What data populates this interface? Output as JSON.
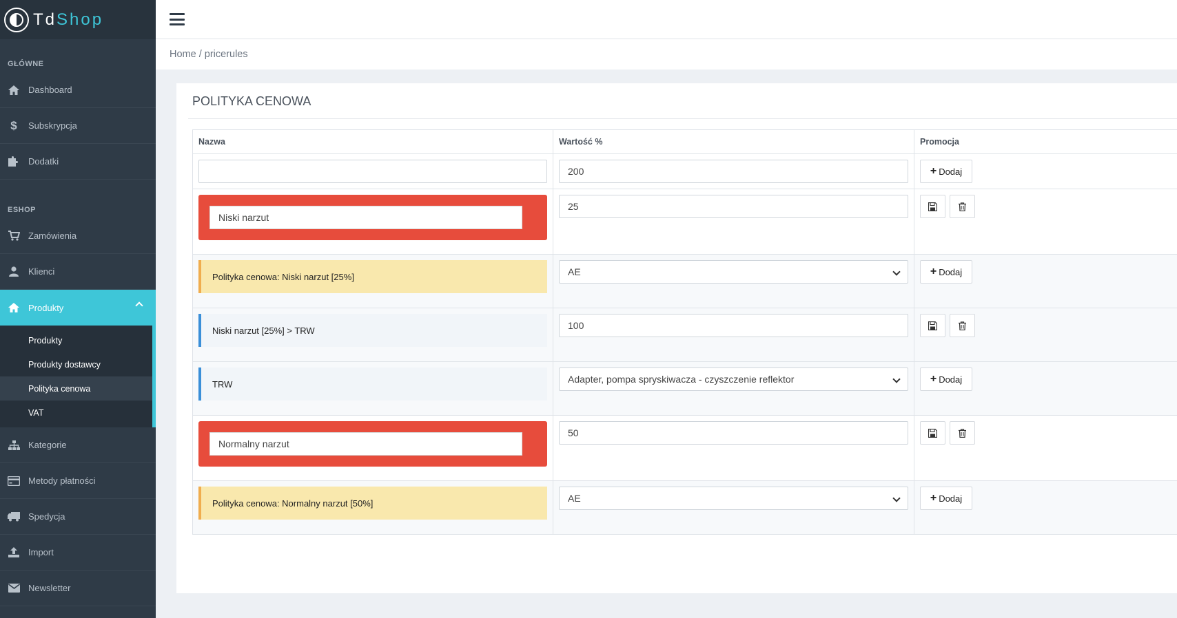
{
  "brand": {
    "name_prefix": "Td",
    "name_accent": "Shop"
  },
  "sidebar": {
    "section_main": "GŁÓWNE",
    "main_items": [
      {
        "label": "Dashboard",
        "icon": "home-icon"
      },
      {
        "label": "Subskrypcja",
        "icon": "dollar-icon"
      },
      {
        "label": "Dodatki",
        "icon": "puzzle-icon"
      }
    ],
    "section_eshop": "ESHOP",
    "eshop_items": [
      {
        "label": "Zamówienia",
        "icon": "cart-icon"
      },
      {
        "label": "Klienci",
        "icon": "user-icon"
      }
    ],
    "active_item": {
      "label": "Produkty",
      "icon": "home-icon"
    },
    "sub_items": [
      "Produkty",
      "Produkty dostawcy",
      "Polityka cenowa",
      "VAT"
    ],
    "lower_items": [
      {
        "label": "Kategorie",
        "icon": "sitemap-icon"
      },
      {
        "label": "Metody płatności",
        "icon": "credit-card-icon"
      },
      {
        "label": "Spedycja",
        "icon": "truck-icon"
      },
      {
        "label": "Import",
        "icon": "upload-icon"
      },
      {
        "label": "Newsletter",
        "icon": "envelope-icon"
      }
    ]
  },
  "breadcrumb": "Home / pricerules",
  "card": {
    "title": "POLITYKA CENOWA",
    "headers": [
      "Nazwa",
      "Wartość %",
      "Promocja"
    ],
    "new_row": {
      "name_value": "",
      "value": "200",
      "add_label": "Dodaj"
    },
    "rows": [
      {
        "kind": "red",
        "name": "Niski narzut",
        "value": "25"
      },
      {
        "kind": "yellow",
        "name": "Polityka cenowa: Niski narzut [25%]",
        "select": "AE",
        "add_label": "Dodaj"
      },
      {
        "kind": "blue",
        "name": "Niski narzut [25%] > TRW",
        "value": "100"
      },
      {
        "kind": "blue",
        "name": "TRW",
        "select": "Adapter, pompa spryskiwacza - czyszczenie reflektor",
        "add_label": "Dodaj"
      },
      {
        "kind": "red",
        "name": "Normalny narzut",
        "value": "50"
      },
      {
        "kind": "yellow",
        "name": "Polityka cenowa: Normalny narzut [50%]",
        "select": "AE",
        "add_label": "Dodaj"
      }
    ]
  },
  "colors": {
    "accent": "#3ec6d8",
    "danger": "#e74c3c",
    "warning": "#f0ad4e",
    "info": "#3a8fd8",
    "sidebar": "#2f3b47"
  }
}
